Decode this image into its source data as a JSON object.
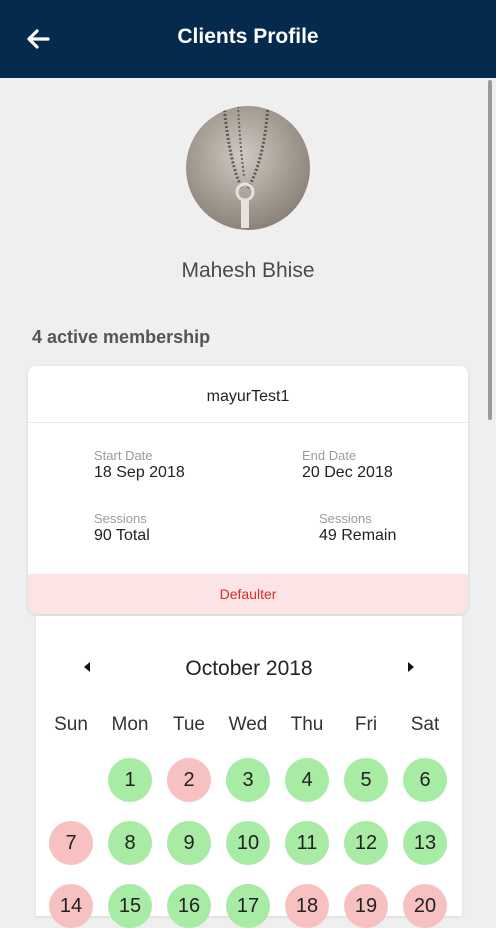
{
  "header": {
    "title": "Clients Profile",
    "back_icon": "arrow-left-icon"
  },
  "profile": {
    "name": "Mahesh Bhise"
  },
  "memberships": {
    "count_label": "4 active membership",
    "card": {
      "name": "mayurTest1",
      "start_label": "Start Date",
      "start_value": "18 Sep 2018",
      "end_label": "End Date",
      "end_value": "20 Dec 2018",
      "sessions_label": "Sessions",
      "sessions_total": "90 Total",
      "sessions_remain_label": "Sessions",
      "sessions_remain": "49 Remain",
      "status": "Defaulter"
    }
  },
  "calendar": {
    "month": "October 2018",
    "weekdays": [
      "Sun",
      "Mon",
      "Tue",
      "Wed",
      "Thu",
      "Fri",
      "Sat"
    ],
    "days": [
      {
        "label": "1",
        "state": "present"
      },
      {
        "label": "2",
        "state": "absent"
      },
      {
        "label": "3",
        "state": "present"
      },
      {
        "label": "4",
        "state": "present"
      },
      {
        "label": "5",
        "state": "present"
      },
      {
        "label": "6",
        "state": "present"
      },
      {
        "label": "7",
        "state": "absent"
      },
      {
        "label": "8",
        "state": "present"
      },
      {
        "label": "9",
        "state": "present"
      },
      {
        "label": "10",
        "state": "present"
      },
      {
        "label": "11",
        "state": "present"
      },
      {
        "label": "12",
        "state": "present"
      },
      {
        "label": "13",
        "state": "present"
      },
      {
        "label": "14",
        "state": "absent"
      },
      {
        "label": "15",
        "state": "present"
      },
      {
        "label": "16",
        "state": "present"
      },
      {
        "label": "17",
        "state": "present"
      },
      {
        "label": "18",
        "state": "absent"
      },
      {
        "label": "19",
        "state": "absent"
      },
      {
        "label": "20",
        "state": "absent"
      }
    ],
    "colors": {
      "present": "#a8eba4",
      "absent": "#f7c1c1"
    }
  }
}
